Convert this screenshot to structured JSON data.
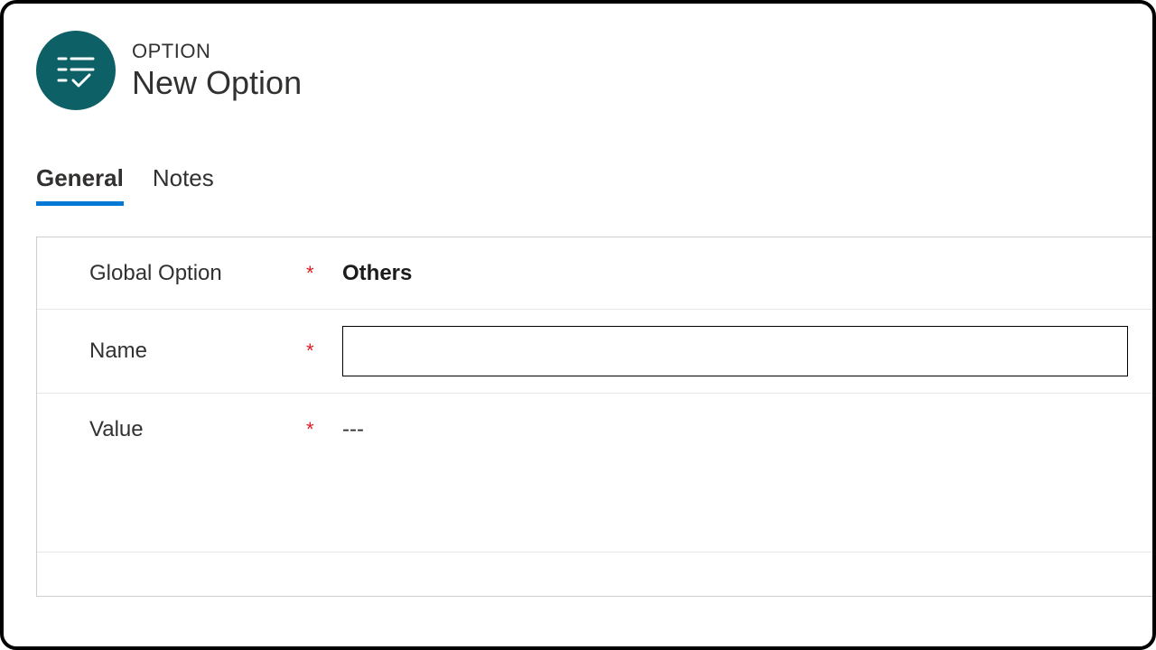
{
  "header": {
    "eyebrow": "OPTION",
    "title": "New Option"
  },
  "tabs": [
    {
      "id": "general",
      "label": "General",
      "active": true
    },
    {
      "id": "notes",
      "label": "Notes",
      "active": false
    }
  ],
  "form": {
    "global_option": {
      "label": "Global Option",
      "required": true,
      "required_mark": "*",
      "value": "Others"
    },
    "name": {
      "label": "Name",
      "required": true,
      "required_mark": "*",
      "value": ""
    },
    "value_field": {
      "label": "Value",
      "required": true,
      "required_mark": "*",
      "value": "---"
    }
  }
}
